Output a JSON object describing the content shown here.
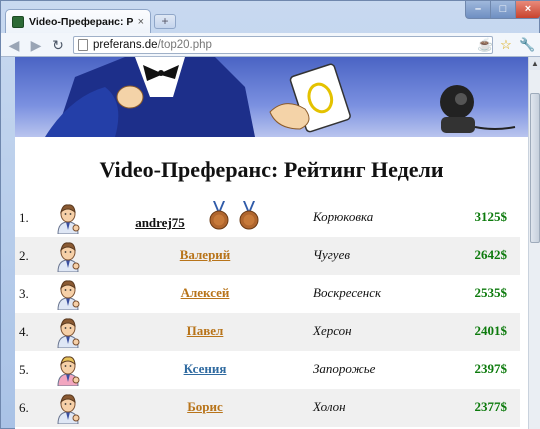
{
  "browser": {
    "tab_title": "Video-Преферанс: Рейтин...",
    "tab_close": "×",
    "new_tab": "+",
    "window_controls": {
      "minimize": "–",
      "maximize": "□",
      "close": "×"
    },
    "url_host": "preferans.de",
    "url_path": "/top20.php",
    "icons": [
      "back-icon",
      "forward-icon",
      "reload-icon",
      "page-icon",
      "extension-icon",
      "star-icon",
      "wrench-icon"
    ]
  },
  "page": {
    "title": "Video-Преферанс: Рейтинг Недели",
    "rows": [
      {
        "rank": "1.",
        "name": "andrej75",
        "city": "Корюковка",
        "score": "3125$",
        "name_color": "#111111",
        "avatar": "male",
        "medals": 2
      },
      {
        "rank": "2.",
        "name": "Валерий",
        "city": "Чугуев",
        "score": "2642$",
        "name_color": "#b8741a",
        "avatar": "male",
        "medals": 0
      },
      {
        "rank": "3.",
        "name": "Алексей",
        "city": "Воскресенск",
        "score": "2535$",
        "name_color": "#b8741a",
        "avatar": "male",
        "medals": 0
      },
      {
        "rank": "4.",
        "name": "Павел",
        "city": "Херсон",
        "score": "2401$",
        "name_color": "#b8741a",
        "avatar": "male",
        "medals": 0
      },
      {
        "rank": "5.",
        "name": "Ксения",
        "city": "Запорожье",
        "score": "2397$",
        "name_color": "#2f6aa0",
        "avatar": "female",
        "medals": 0
      },
      {
        "rank": "6.",
        "name": "Борис",
        "city": "Холон",
        "score": "2377$",
        "name_color": "#b8741a",
        "avatar": "male",
        "medals": 0
      }
    ]
  },
  "colors": {
    "score": "#0c7a0c",
    "chrome_frame": "#b9cde8",
    "row_alt": "#f0f0f0"
  }
}
